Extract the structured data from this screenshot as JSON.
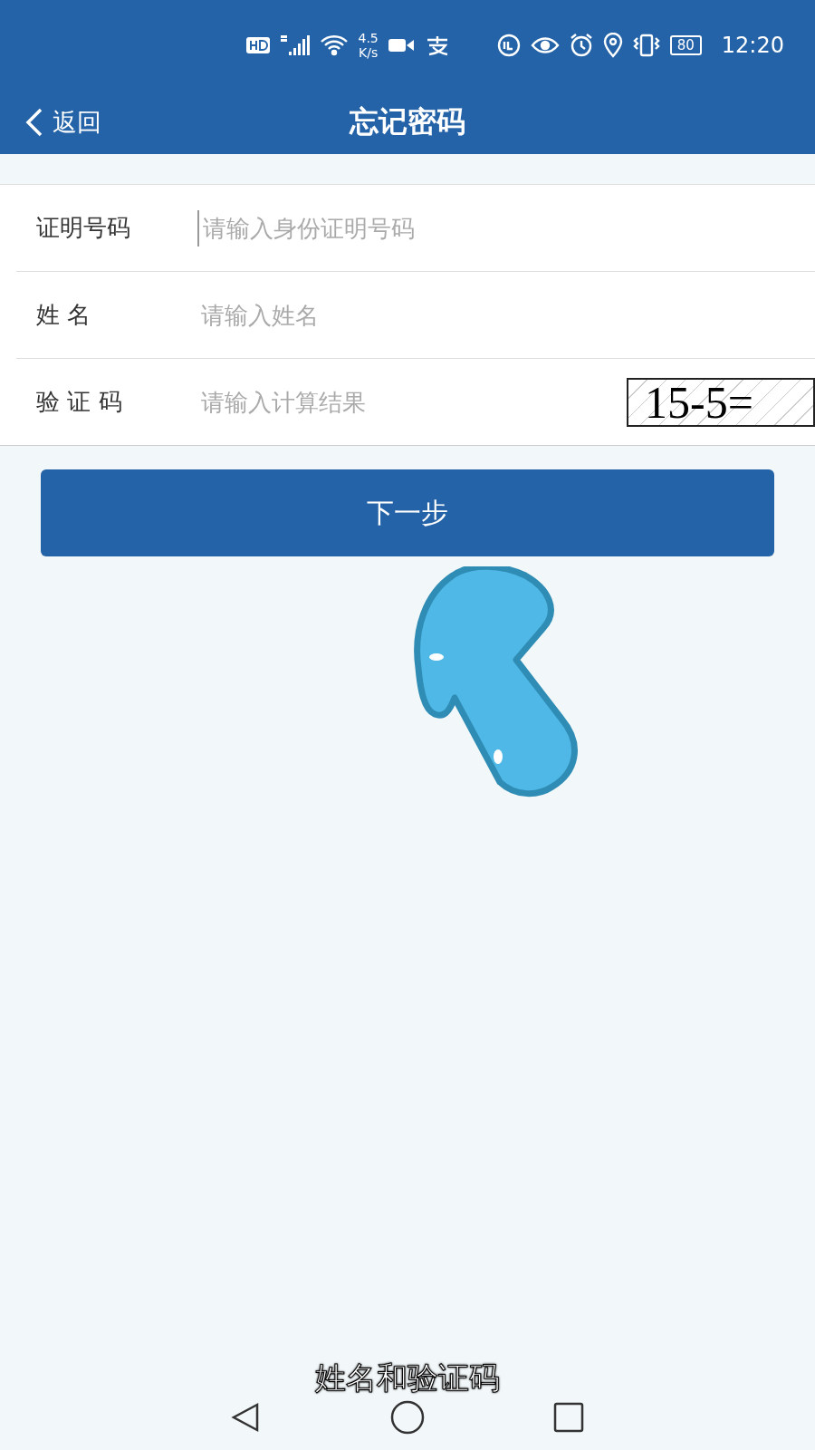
{
  "status_bar": {
    "speed_value": "4.5",
    "speed_unit": "K/s",
    "battery": "80",
    "time": "12:20"
  },
  "header": {
    "back": "返回",
    "title": "忘记密码"
  },
  "form": {
    "fields": [
      {
        "kind": "text",
        "label": "证明号码",
        "placeholder": "请输入身份证明号码",
        "focused": true
      },
      {
        "kind": "text",
        "label": "姓 名",
        "placeholder": "请输入姓名",
        "focused": false
      },
      {
        "kind": "captcha",
        "label": "验 证 码",
        "placeholder": "请输入计算结果",
        "focused": false,
        "captcha": "15-5="
      }
    ]
  },
  "next_button": "下一步",
  "subtitle": "姓名和验证码"
}
